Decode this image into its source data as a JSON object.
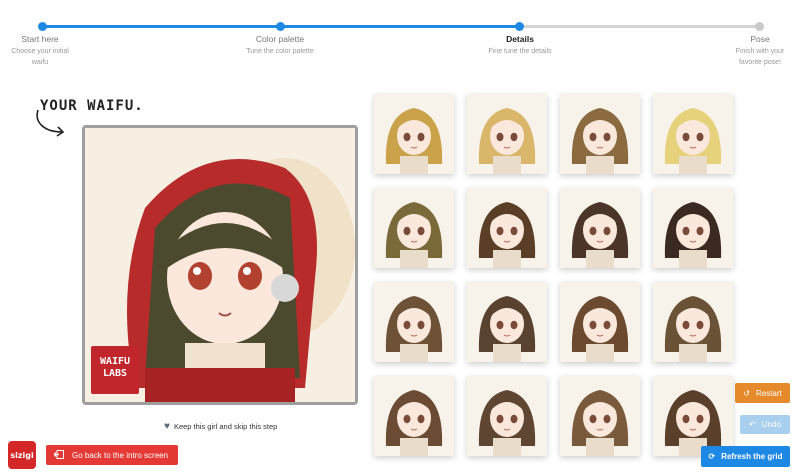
{
  "steps": [
    {
      "title": "Start here",
      "subtitle_line1": "Choose your initial",
      "subtitle_line2": "waifu"
    },
    {
      "title": "Color palette",
      "subtitle_line1": "Tune the color palette",
      "subtitle_line2": ""
    },
    {
      "title": "Details",
      "subtitle_line1": "Fine tune the details",
      "subtitle_line2": ""
    },
    {
      "title": "Pose",
      "subtitle_line1": "Finish with your",
      "subtitle_line2": "favorite pose!"
    }
  ],
  "heading": "YOUR WAIFU.",
  "logo_badge": {
    "line1": "WAIFU",
    "line2": "LABS"
  },
  "keep_label": "Keep this girl and skip this step",
  "app_logo_text": "sizigi",
  "back_label": "Go back to the intro screen",
  "restart_label": "Restart",
  "undo_label": "Undo",
  "refresh_label": "Refresh the grid",
  "colors": {
    "accent": "#1e88e5",
    "restart": "#e6892a",
    "danger": "#e53935",
    "undo_disabled": "#a8d0ee"
  },
  "grid_hair_colors": [
    "#c9a24a",
    "#d9b66a",
    "#8a6a3e",
    "#e6d27a",
    "#7a6a3a",
    "#5a3e26",
    "#4a3528",
    "#3b2a22",
    "#6e5238",
    "#5a4230",
    "#6b4a30",
    "#6a5236",
    "#6b4b33",
    "#5e4632",
    "#7a5a3c",
    "#5a3f2a"
  ]
}
